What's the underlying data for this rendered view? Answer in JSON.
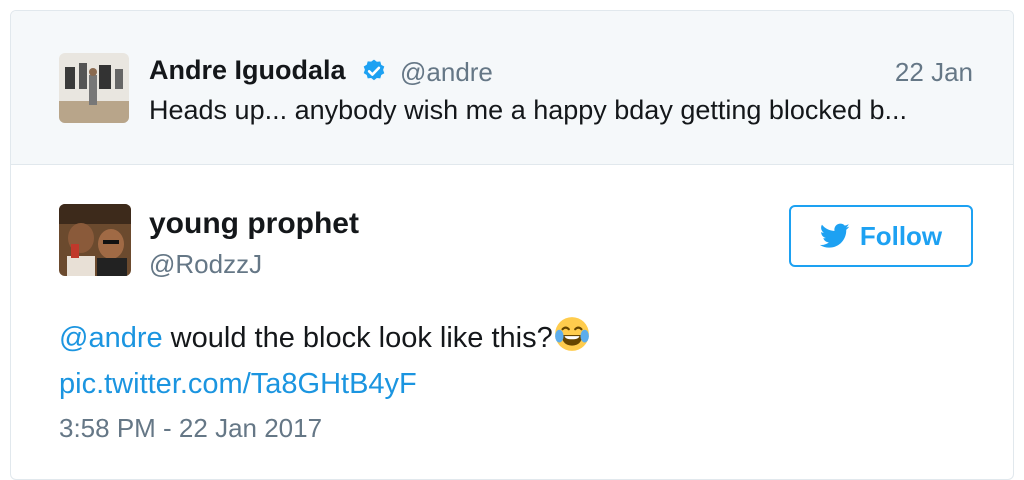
{
  "parent_tweet": {
    "author_name": "Andre Iguodala",
    "handle": "@andre",
    "date": "22 Jan",
    "text": "Heads up... anybody wish me a happy bday getting blocked b...",
    "verified_icon": "verified-badge-icon"
  },
  "tweet": {
    "author_name": "young prophet",
    "handle": "@RodzzJ",
    "follow_label": "Follow",
    "mention": "@andre",
    "text_after_mention": " would the block look like this?",
    "emoji_icon": "face-with-tears-of-joy-icon",
    "link": "pic.twitter.com/Ta8GHtB4yF",
    "timestamp": "3:58 PM - 22 Jan 2017"
  },
  "colors": {
    "accent": "#1da1f2",
    "link": "#1b95e0",
    "muted": "#657786",
    "text": "#14171a",
    "parent_bg": "#f5f8fa"
  }
}
